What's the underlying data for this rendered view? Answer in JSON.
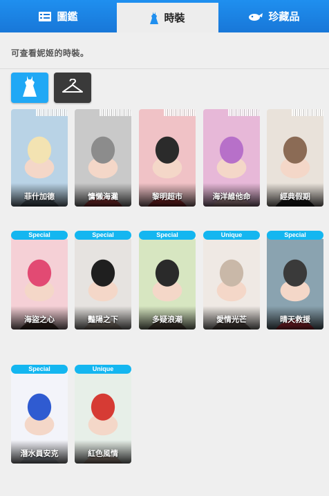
{
  "tabs": [
    {
      "label": "圖鑑",
      "icon": "list-icon"
    },
    {
      "label": "時裝",
      "icon": "dress-icon"
    },
    {
      "label": "珍藏品",
      "icon": "collectible-icon"
    }
  ],
  "description": "可查看妮姬的時裝。",
  "filters": [
    {
      "icon": "dress-icon",
      "active": true
    },
    {
      "icon": "hanger-icon",
      "active": false
    }
  ],
  "costumes": [
    {
      "name": "菲什加德",
      "badge": null
    },
    {
      "name": "慵懶海灘",
      "badge": null
    },
    {
      "name": "黎明超市",
      "badge": null
    },
    {
      "name": "海洋維他命",
      "badge": null
    },
    {
      "name": "經典假期",
      "badge": null
    },
    {
      "name": "海盜之心",
      "badge": "Special"
    },
    {
      "name": "豔陽之下",
      "badge": "Special"
    },
    {
      "name": "多疑浪潮",
      "badge": "Special"
    },
    {
      "name": "愛情光芒",
      "badge": "Unique"
    },
    {
      "name": "晴天救援",
      "badge": "Special"
    },
    {
      "name": "潛水員安克",
      "badge": "Special"
    },
    {
      "name": "紅色風情",
      "badge": "Unique"
    }
  ],
  "colors": {
    "accent": "#1f8fef",
    "badge": "#14b6f0"
  }
}
